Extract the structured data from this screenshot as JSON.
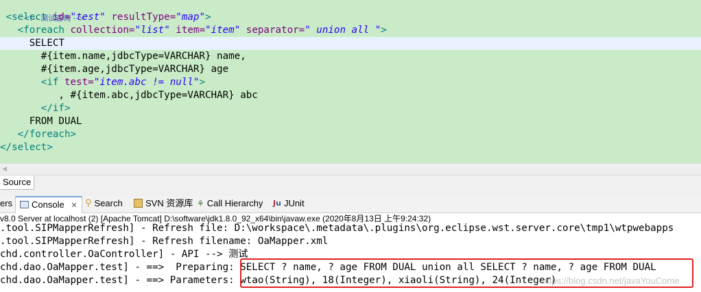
{
  "editor": {
    "lines": {
      "comment": "<!-- 测试查询 -->",
      "select_open": {
        "tag": "<select",
        "attr1": "id=",
        "val1": "\"test\"",
        "attr2": "resultType=",
        "val2": "\"map\"",
        "close": ">"
      },
      "foreach_open": {
        "tag": "<foreach",
        "attr1": "collection=",
        "val1": "\"list\"",
        "attr2": "item=",
        "val2": "\"item\"",
        "attr3": "separator=",
        "val3": "\" union all \"",
        "close": ">"
      },
      "select_kw": "SELECT",
      "name_line": "#{item.name,jdbcType=VARCHAR} name,",
      "age_line": "#{item.age,jdbcType=VARCHAR} age",
      "if_open": {
        "tag": "<if",
        "attr": "test=",
        "val": "\"item.abc != null\"",
        "close": ">"
      },
      "abc_line": ", #{item.abc,jdbcType=VARCHAR} abc",
      "if_close": "</if>",
      "from_line": "FROM DUAL",
      "foreach_close": "</foreach>",
      "select_close": "</select>"
    }
  },
  "source_tab": {
    "label": "Source"
  },
  "view_tabs": {
    "servers_partial": "ers",
    "console": "Console",
    "close": "✕",
    "search": "Search",
    "svn": "SVN 资源库",
    "call_hierarchy": "Call Hierarchy",
    "junit": "JUnit"
  },
  "console": {
    "header": "v8.0 Server at localhost (2) [Apache Tomcat] D:\\software\\jdk1.8.0_92_x64\\bin\\javaw.exe (2020年8月13日 上午9:24:32)",
    "lines": [
      ".tool.SIPMapperRefresh] - Refresh file: D:\\workspace\\.metadata\\.plugins\\org.eclipse.wst.server.core\\tmp1\\wtpwebapps",
      ".tool.SIPMapperRefresh] - Refresh filename: OaMapper.xml",
      "chd.controller.OaController] - API --> 测试",
      "chd.dao.OaMapper.test] - ==>  Preparing: SELECT ? name, ? age FROM DUAL union all SELECT ? name, ? age FROM DUAL",
      "chd.dao.OaMapper.test] - ==> Parameters: wtao(String), 18(Integer), xiaoli(String), 24(Integer)"
    ]
  },
  "watermark": "https://blog.csdn.net/javaYouCome",
  "colors": {
    "editor_bg": "#c9ebc7",
    "tag": "#008080",
    "attribute": "#7f007f",
    "string": "#2a00ff",
    "comment": "#3f5fbf",
    "highlight_box": "#e02020"
  }
}
